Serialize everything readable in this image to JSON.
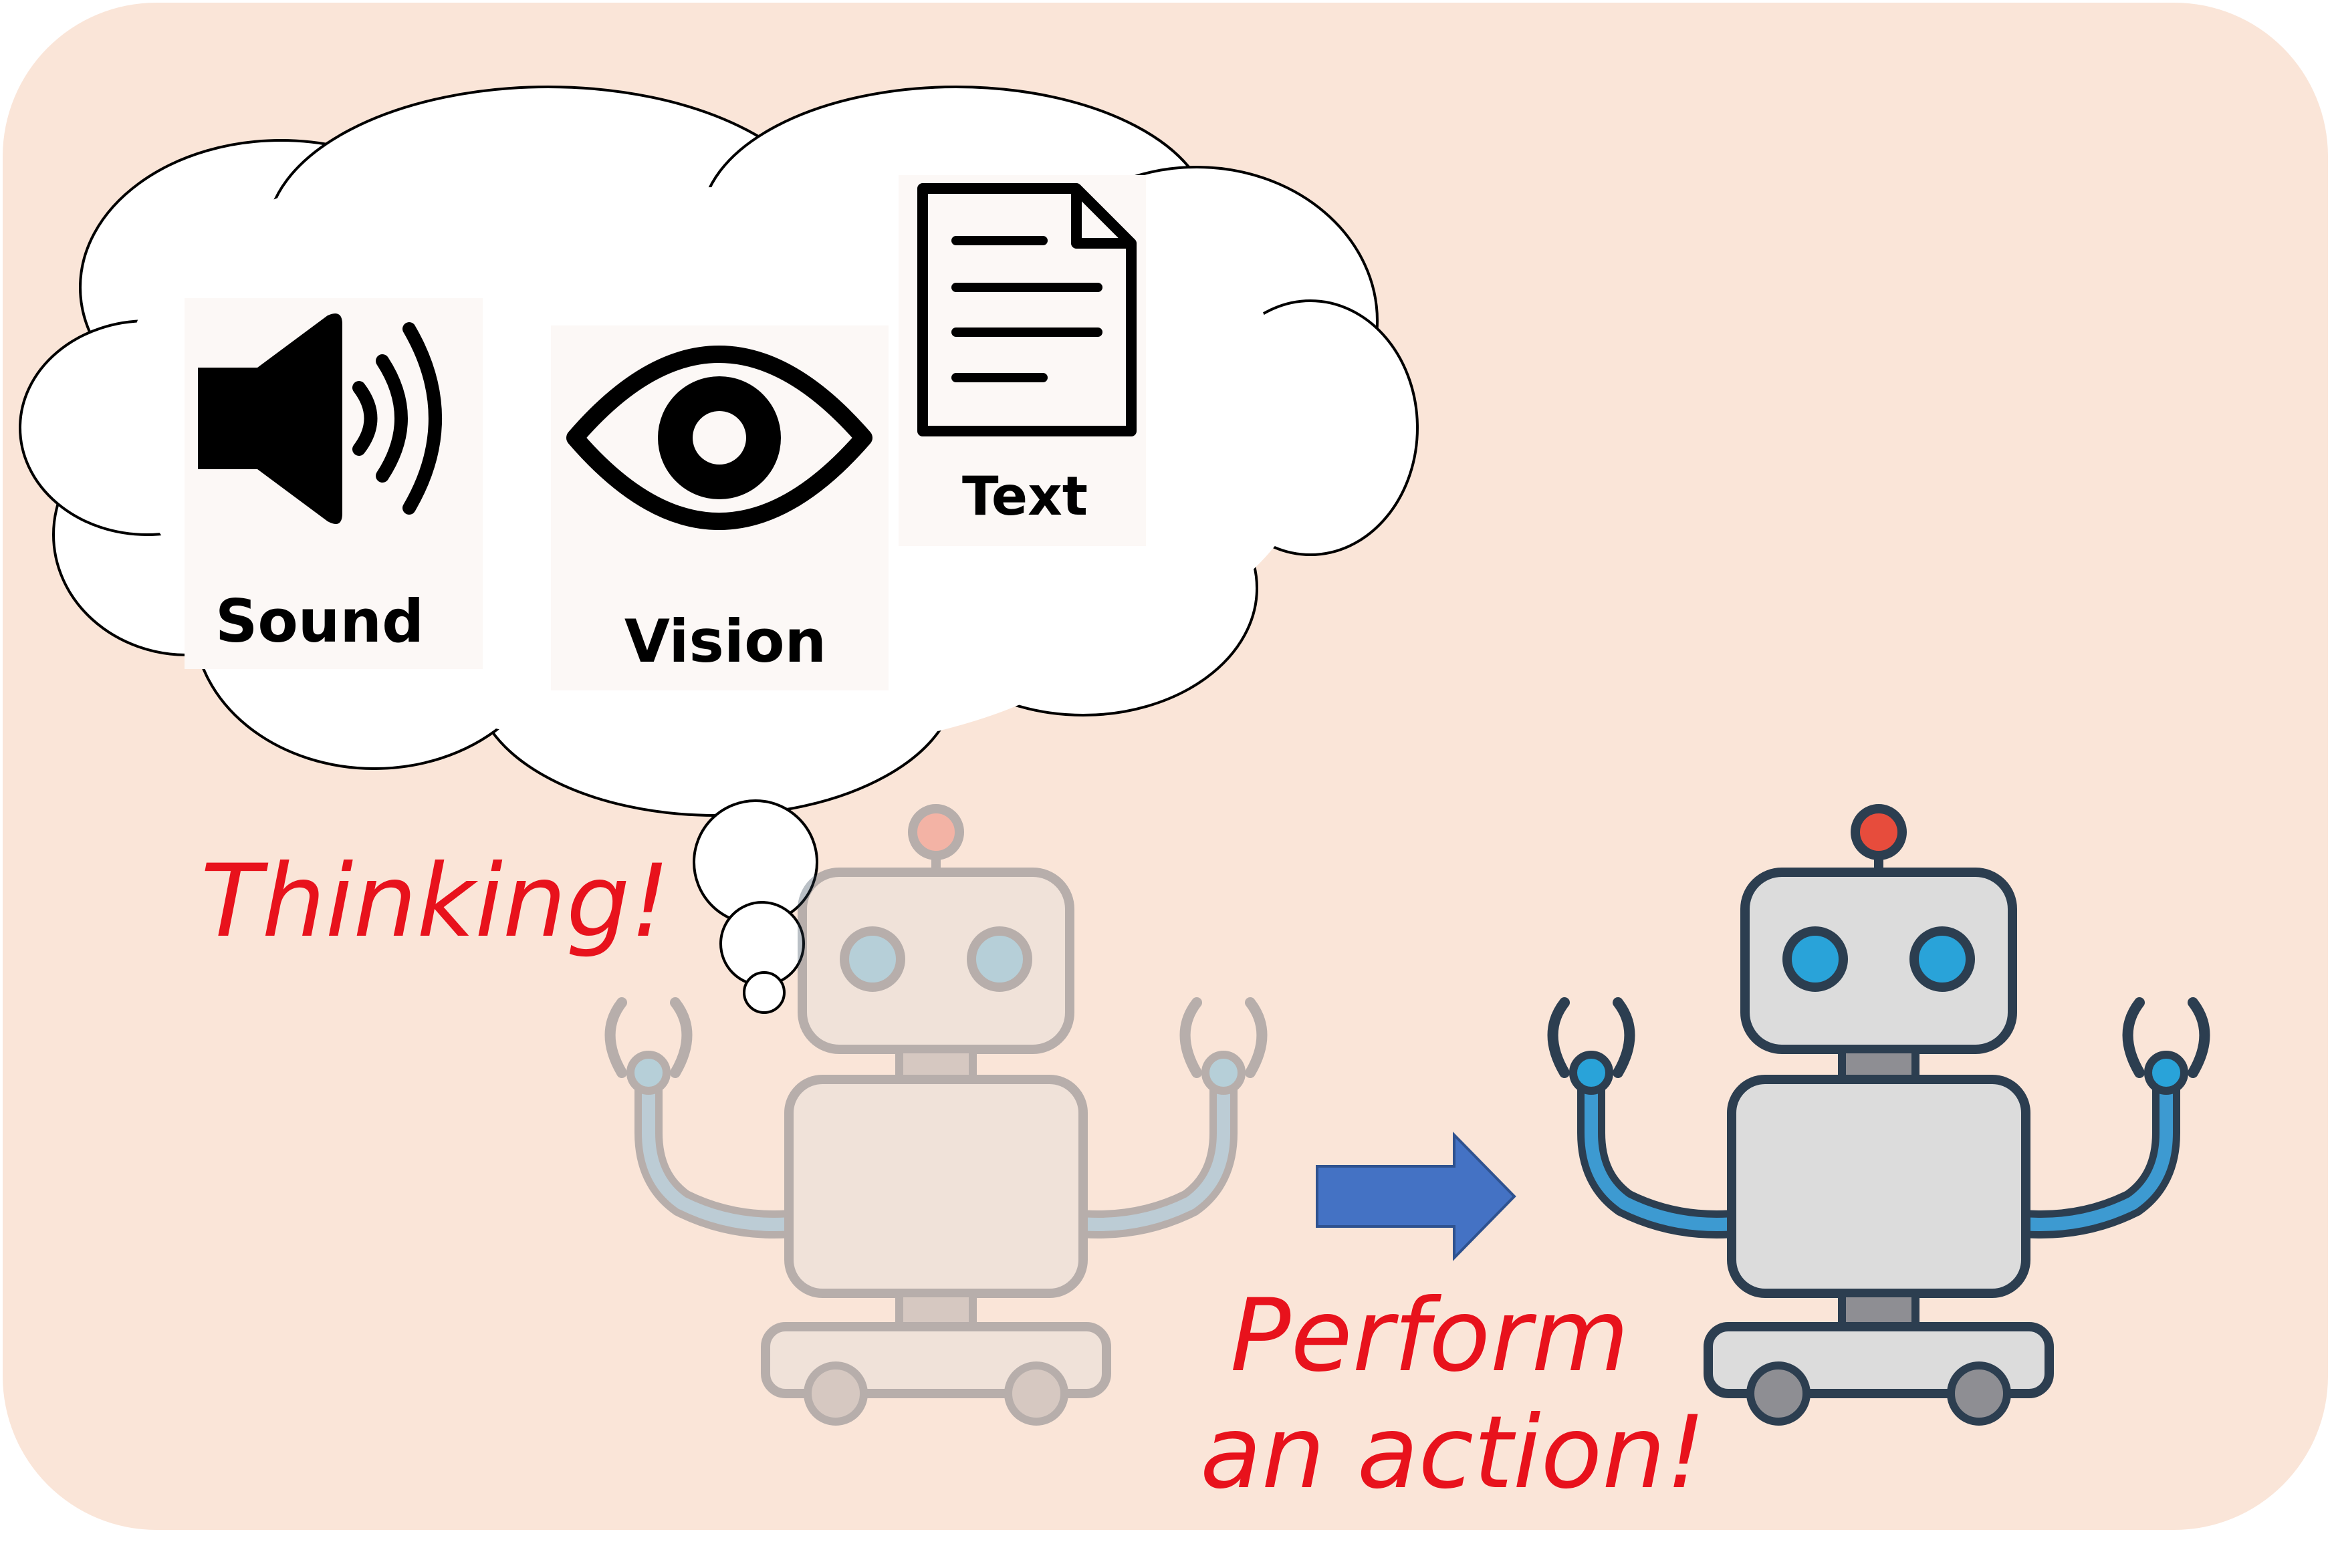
{
  "thought_cloud": {
    "items": [
      {
        "label": "Sound",
        "icon": "speaker-icon"
      },
      {
        "label": "Vision",
        "icon": "eye-icon"
      },
      {
        "label": "Text",
        "icon": "document-icon"
      }
    ]
  },
  "captions": {
    "thinking": "Thinking!",
    "perform_line1": "Perform",
    "perform_line2": "an action!"
  },
  "colors": {
    "background": "#FAE5D8",
    "caption_red": "#E8121C",
    "arrow_blue": "#4472C4",
    "robot_outline": "#2C3E50",
    "robot_body": "#DCDCDC",
    "robot_eye": "#29A3D9",
    "antenna_bulb": "#E74C3C",
    "arm_blue": "#3D9AD1"
  }
}
